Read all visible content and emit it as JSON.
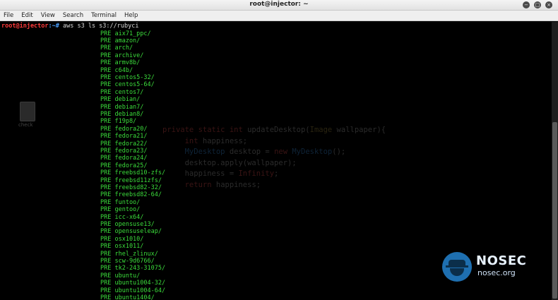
{
  "window": {
    "title": "root@injector: ~"
  },
  "menu": [
    "File",
    "Edit",
    "View",
    "Search",
    "Terminal",
    "Help"
  ],
  "prompt": {
    "user": "root@injector",
    "path": ":~#",
    "command": " aws s3 ls s3://rubyci"
  },
  "listing": [
    "PRE aix71_ppc/",
    "PRE amazon/",
    "PRE arch/",
    "PRE archive/",
    "PRE armv8b/",
    "PRE c64b/",
    "PRE centos5-32/",
    "PRE centos5-64/",
    "PRE centos7/",
    "PRE debian/",
    "PRE debian7/",
    "PRE debian8/",
    "PRE f19p8/",
    "PRE fedora20/",
    "PRE fedora21/",
    "PRE fedora22/",
    "PRE fedora23/",
    "PRE fedora24/",
    "PRE fedora25/",
    "PRE freebsd10-zfs/",
    "PRE freebsd11zfs/",
    "PRE freebsd82-32/",
    "PRE freebsd82-64/",
    "PRE funtoo/",
    "PRE gentoo/",
    "PRE icc-x64/",
    "PRE opensuse13/",
    "PRE opensuseleap/",
    "PRE osx1010/",
    "PRE osx1011/",
    "PRE rhel_zlinux/",
    "PRE scw-9d6766/",
    "PRE tk2-243-31075/",
    "PRE ubuntu/",
    "PRE ubuntu1004-32/",
    "PRE ubuntu1004-64/",
    "PRE ubuntu1404/"
  ],
  "desktop_icon": {
    "label": "check"
  },
  "wallpaper_code": {
    "l1": {
      "kw": "private static int ",
      "rest": "updateDesktop(",
      "type": "Image",
      "rest2": " wallpaper){"
    },
    "l2": {
      "kw": "int",
      "rest": " happiness;"
    },
    "l3": {
      "type": "MyDesktop",
      "rest": " desktop = ",
      "kw": "new ",
      "type2": "MyDesktop",
      "rest2": "();"
    },
    "l4": {
      "rest": "desktop.apply(wallpaper);"
    },
    "l5": {
      "rest": "happiness = ",
      "kw": "Infinity",
      "rest2": ";"
    },
    "l6": {
      "kw": "return",
      "rest": " happiness;"
    }
  },
  "logo": {
    "title": "NOSEC",
    "subtitle": "nosec.org"
  },
  "colors": {
    "listing": "#3bdc3b",
    "prompt_user": "#ff3b3b",
    "prompt_path": "#4aa0ff",
    "logo": "#1e6fb0"
  }
}
